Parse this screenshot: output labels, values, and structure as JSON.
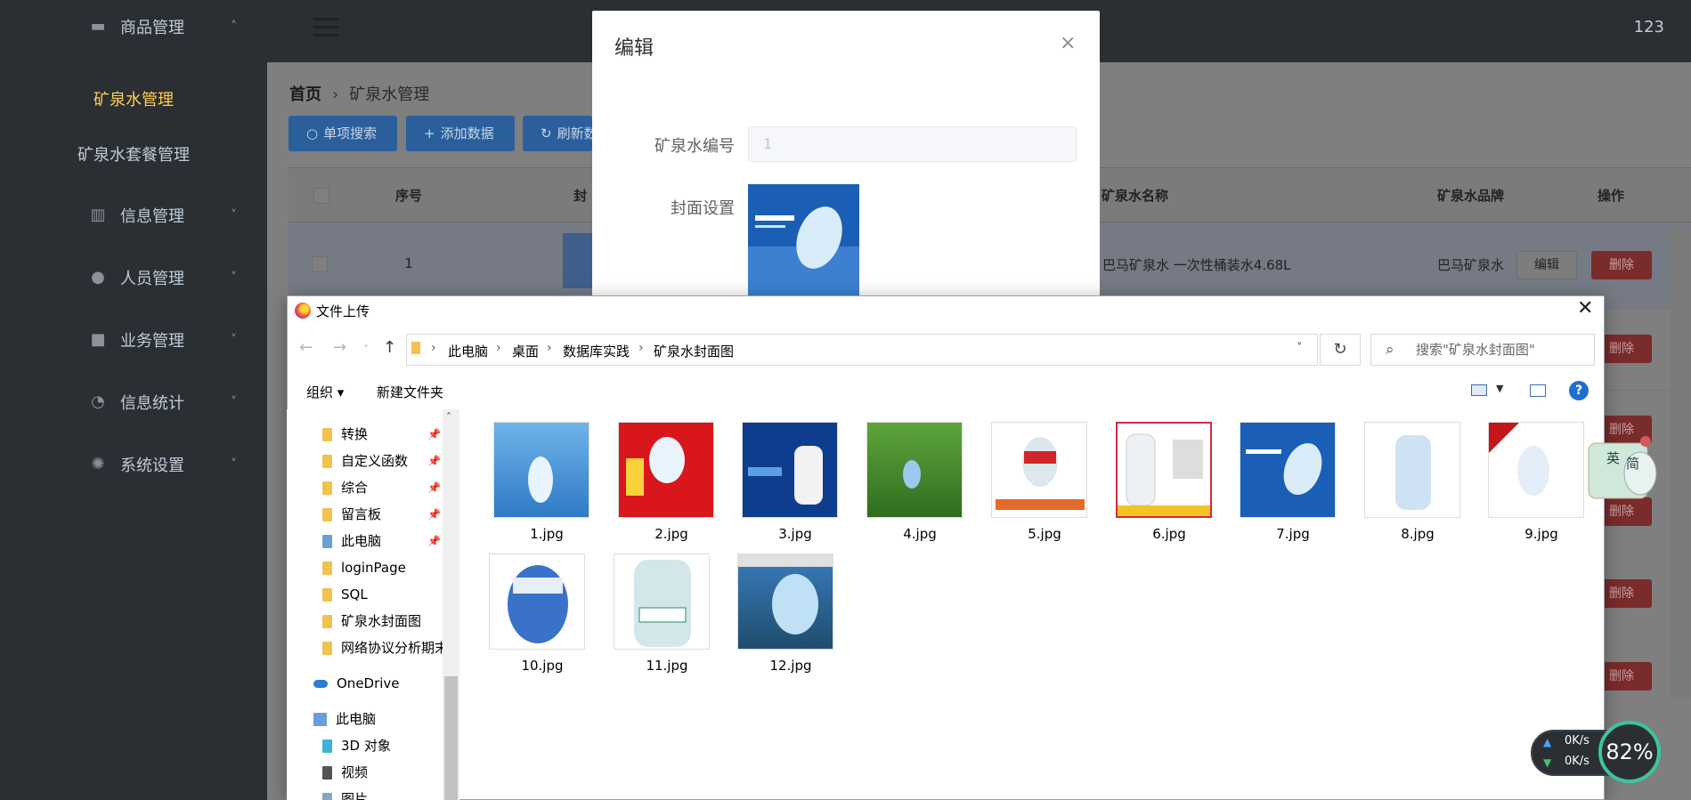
{
  "sidebar": {
    "items": [
      {
        "label": "商品管理",
        "icon": "briefcase-icon"
      },
      {
        "label": "信息管理",
        "icon": "book-icon"
      },
      {
        "label": "人员管理",
        "icon": "user-icon"
      },
      {
        "label": "业务管理",
        "icon": "bag-icon"
      },
      {
        "label": "信息统计",
        "icon": "pie-chart-icon"
      },
      {
        "label": "系统设置",
        "icon": "gear-icon"
      }
    ],
    "sub_items": [
      {
        "label": "矿泉水管理",
        "active": true
      },
      {
        "label": "矿泉水套餐管理",
        "active": false
      }
    ]
  },
  "header": {
    "username": "123"
  },
  "breadcrumb": {
    "home": "首页",
    "current": "矿泉水管理"
  },
  "toolbar": {
    "search_label": "单项搜索",
    "add_label": "添加数据",
    "refresh_label": "刷新数"
  },
  "table": {
    "headers": {
      "index": "序号",
      "cover": "封",
      "name": "矿泉水名称",
      "brand": "矿泉水品牌",
      "actions": "操作"
    },
    "row1": {
      "index": "1",
      "name": "巴马矿泉水 一次性桶装水4.68L",
      "brand": "巴马矿泉水"
    },
    "edit_label": "编辑",
    "delete_label": "删除"
  },
  "dialog": {
    "title": "编辑",
    "close": "×",
    "id_label": "矿泉水编号",
    "id_value": "1",
    "cover_label": "封面设置"
  },
  "file_dialog": {
    "title": "文件上传",
    "breadcrumb": [
      "此电脑",
      "桌面",
      "数据库实践",
      "矿泉水封面图"
    ],
    "search_placeholder": "搜索\"矿泉水封面图\"",
    "organize_label": "组织 ▾",
    "new_folder_label": "新建文件夹",
    "nav_items": [
      "转换",
      "自定义函数",
      "综合",
      "留言板",
      "此电脑",
      "loginPage",
      "SQL",
      "矿泉水封面图",
      "网络协议分析期末",
      "OneDrive",
      "此电脑",
      "3D 对象",
      "视频",
      "图片"
    ],
    "files": [
      "1.jpg",
      "2.jpg",
      "3.jpg",
      "4.jpg",
      "5.jpg",
      "6.jpg",
      "7.jpg",
      "8.jpg",
      "9.jpg",
      "10.jpg",
      "11.jpg",
      "12.jpg"
    ]
  },
  "ime": {
    "en": "英",
    "zh": "简"
  },
  "network": {
    "up": "0K/s",
    "down": "0K/s",
    "percent": "82%"
  },
  "colors": {
    "sidebar_bg": "#2b2f33",
    "active_menu": "#ffd04b",
    "primary": "#2a5f9c",
    "danger": "#7a2b2b"
  }
}
